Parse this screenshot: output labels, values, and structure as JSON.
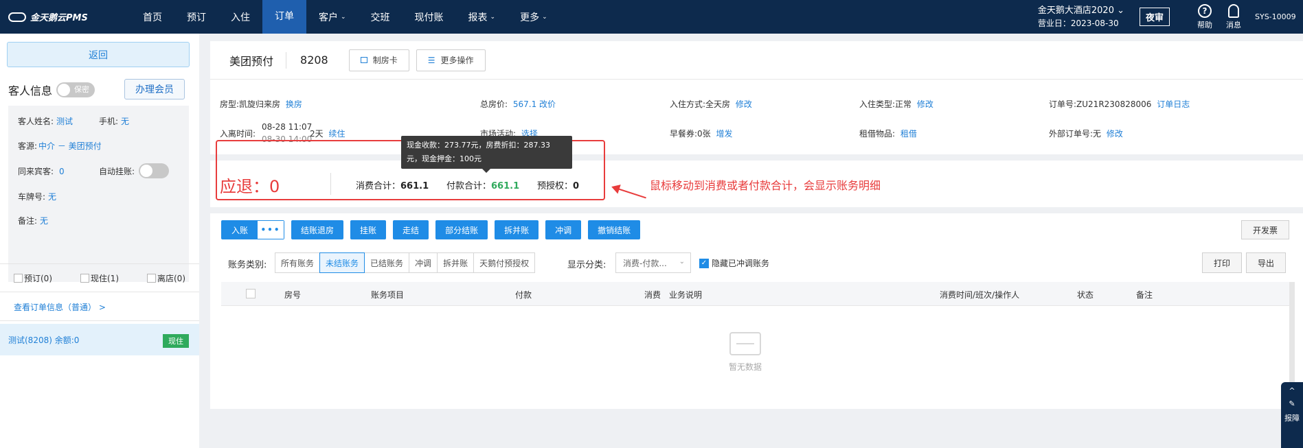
{
  "app": {
    "logo_text": "金天鹅云PMS",
    "nav": [
      "首页",
      "预订",
      "入住",
      "订单",
      "客户",
      "交班",
      "现付账",
      "报表",
      "更多"
    ],
    "nav_caret": "⌄",
    "hotel_name": "金天鹅大酒店2020 ⌄",
    "business_date": "营业日：2023-08-30",
    "night_audit": "夜审",
    "help_label": "帮助",
    "help_icon_glyph": "?",
    "message_label": "消息",
    "user": "SYS-10009"
  },
  "left": {
    "back": "返回",
    "guest_info_title": "客人信息",
    "privacy_toggle": "保密",
    "member_btn": "办理会员",
    "guest_name_label": "客人姓名:",
    "guest_name": "测试",
    "phone_label": "手机:",
    "phone": "无",
    "source_label": "客源:",
    "source": "中介 － 美团预付",
    "companions_label": "同来宾客:",
    "companions": "0",
    "auto_hang_label": "自动挂账:",
    "plate_label": "车牌号:",
    "plate": "无",
    "remark_label": "备注:",
    "remark": "无",
    "checks": [
      "预订(0)",
      "现住(1)",
      "离店(0)"
    ],
    "view_order": "查看订单信息（普通） >",
    "room_row": "测试(8208)  余额:0",
    "room_status": "现住"
  },
  "order": {
    "source": "美团预付",
    "room": "8208",
    "make_card": "制房卡",
    "more_ops": "更多操作",
    "room_type_label": "房型:",
    "room_type": "凯旋归来房",
    "change_room": "换房",
    "total_price_label": "总房价:",
    "total_price": "567.1 改价",
    "checkin_mode_label": "入住方式:",
    "checkin_mode": "全天房",
    "modify": "修改",
    "checkin_type_label": "入住类型:",
    "checkin_type": "正常",
    "order_no_label": "订单号:",
    "order_no": "ZU21R230828006",
    "order_log": "订单日志",
    "stay_label": "入离时间:",
    "stay_in": "08-28 11:07",
    "stay_out": "08-30 14:00",
    "stay_days": "2天",
    "extend": "续住",
    "market_label": "市场活动:",
    "market_select": "选择",
    "breakfast_label": "早餐券:",
    "breakfast": "0张",
    "breakfast_issue": "增发",
    "rental_label": "租借物品:",
    "rental": "租借",
    "ext_order_label": "外部订单号:",
    "ext_order": "无",
    "ext_modify": "修改"
  },
  "summary": {
    "refund": "应退：0",
    "consume_label": "消费合计：",
    "consume": "661.1",
    "payment_label": "付款合计：",
    "payment": "661.1",
    "preauth_label": "预授权：",
    "preauth": "0",
    "tooltip_line1": "现金收款：273.77元，房费折扣：287.33",
    "tooltip_line2": "元，现金押金：100元",
    "annotation": "鼠标移动到消费或者付款合计，会显示账务明细"
  },
  "billing": {
    "post": "入账",
    "more": "•••",
    "buttons": [
      "结账退房",
      "挂账",
      "走结",
      "部分结账",
      "拆并账",
      "冲调",
      "撤销结账"
    ],
    "invoice": "开发票",
    "category_label": "账务类别:",
    "categories": [
      "所有账务",
      "未结账务",
      "已结账务",
      "冲调",
      "拆并账",
      "天鹅付预授权"
    ],
    "display_label": "显示分类:",
    "display_select": "消费-付款...",
    "display_chevron": "⌄",
    "hide_adjusted": "隐藏已冲调账务",
    "hide_adjusted_check": "✓",
    "print": "打印",
    "export": "导出",
    "columns": [
      "房号",
      "账务项目",
      "付款",
      "消费",
      "业务说明",
      "消费时间/班次/操作人",
      "状态",
      "备注"
    ],
    "empty": "暂无数据"
  },
  "float_tab": {
    "up_glyph": "^",
    "tool_glyph": "✎",
    "label": "报障"
  },
  "colors": {
    "nav_bg": "#0d2a4d",
    "nav_active": "#1f5fae",
    "primary": "#1f8ce6",
    "danger": "#e83c3c",
    "success": "#2faa5c"
  }
}
